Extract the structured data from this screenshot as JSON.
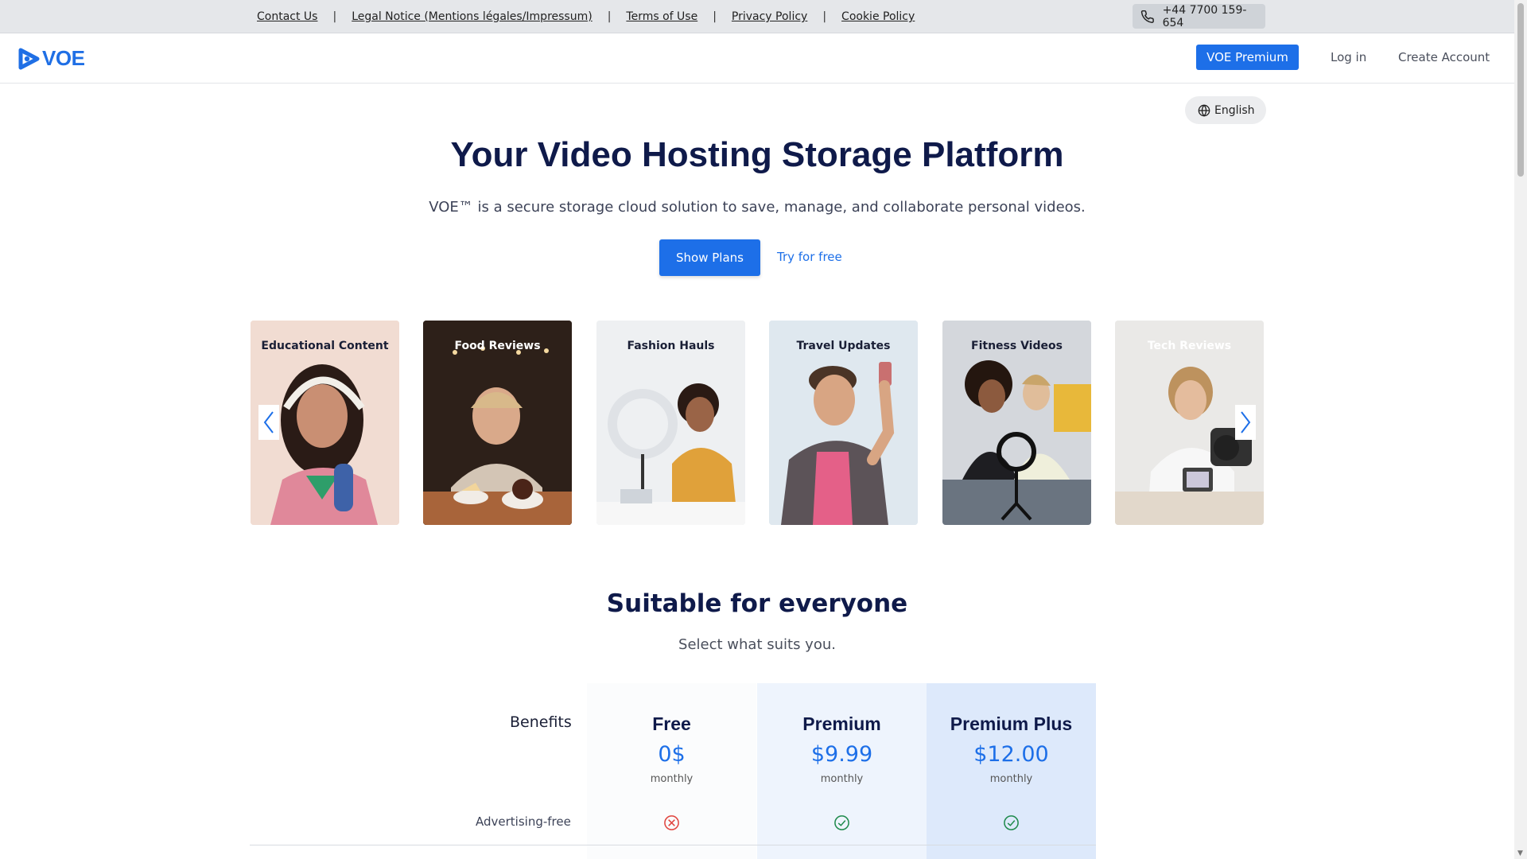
{
  "topbar": {
    "links": [
      "Contact Us",
      "Legal Notice (Mentions légales/Impressum)",
      "Terms of Use",
      "Privacy Policy",
      "Cookie Policy"
    ],
    "separator": "|",
    "phone": "+44 7700 159-654"
  },
  "nav": {
    "logo_text": "VOE",
    "premium_button": "VOE Premium",
    "login": "Log in",
    "create_account": "Create Account"
  },
  "language": {
    "label": "English"
  },
  "hero": {
    "title": "Your Video Hosting Storage Platform",
    "subtitle": "VOE™ is a secure storage cloud solution to save, manage, and collaborate personal videos.",
    "show_plans": "Show Plans",
    "try_free": "Try for free"
  },
  "carousel": {
    "cards": [
      {
        "label": "Educational Content"
      },
      {
        "label": "Food Reviews"
      },
      {
        "label": "Fashion Hauls"
      },
      {
        "label": "Travel Updates"
      },
      {
        "label": "Fitness Videos"
      },
      {
        "label": "Tech Reviews"
      }
    ]
  },
  "pricing": {
    "title": "Suitable for everyone",
    "subtitle": "Select what suits you.",
    "benefits_label": "Benefits",
    "plans": [
      {
        "name": "Free",
        "price": "0$",
        "period": "monthly"
      },
      {
        "name": "Premium",
        "price": "$9.99",
        "period": "monthly"
      },
      {
        "name": "Premium Plus",
        "price": "$12.00",
        "period": "monthly"
      }
    ],
    "rows": [
      {
        "label": "Advertising-free",
        "values": [
          "no",
          "yes",
          "yes"
        ]
      }
    ]
  },
  "colors": {
    "accent": "#1d6fe8",
    "title": "#0f1a4a",
    "no": "#e0443e",
    "yes": "#1f8a4c"
  }
}
